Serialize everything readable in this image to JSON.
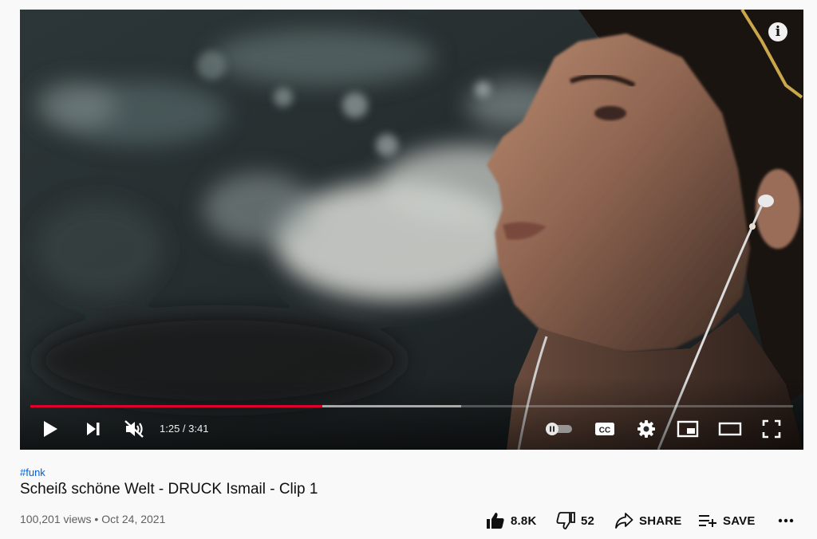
{
  "player": {
    "info_icon": "i",
    "time_current": "1:25",
    "time_total": "3:41",
    "time_separator": " / ",
    "progress_played_fraction": 0.383,
    "progress_buffered_fraction": 0.565,
    "controls": [
      "play-icon",
      "next-icon",
      "muted-volume-icon",
      "autoplay-toggle-icon",
      "captions-icon",
      "settings-icon",
      "miniplayer-icon",
      "theater-mode-icon",
      "fullscreen-icon"
    ],
    "cc_label": "CC"
  },
  "video": {
    "hashtag": "#funk",
    "title": "Scheiß schöne Welt - DRUCK Ismail - Clip 1",
    "views": "100,201 views",
    "separator": "•",
    "date": "Oct 24, 2021"
  },
  "actions": {
    "likes": "8.8K",
    "dislikes": "52",
    "share": "SHARE",
    "save": "SAVE"
  },
  "colors": {
    "progress_played": "#e1002d",
    "link": "#065fd4",
    "text_secondary": "#606060"
  }
}
